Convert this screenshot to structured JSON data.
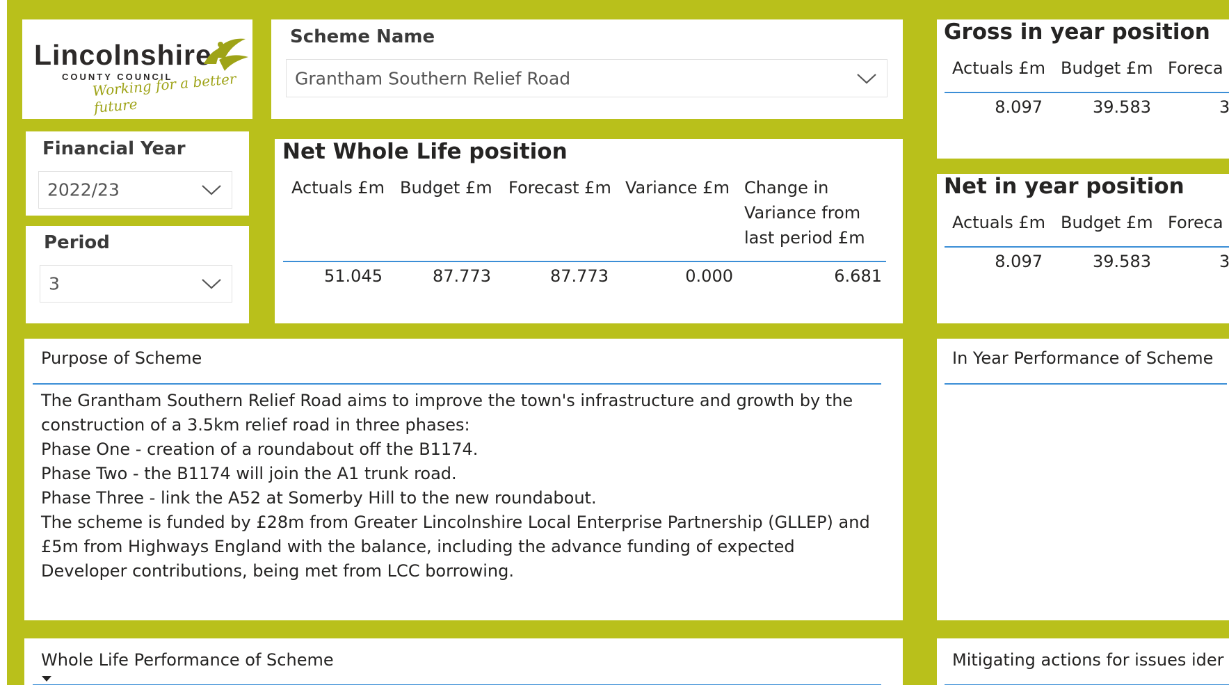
{
  "logo": {
    "name": "Lincolnshire",
    "council": "COUNTY COUNCIL",
    "tagline": "Working for a better future",
    "accent": "#9ea317"
  },
  "colors": {
    "background": "#b9c01b",
    "panel": "#ffffff",
    "rule": "#3b8ed6"
  },
  "scheme": {
    "title": "Scheme Name",
    "value": "Grantham Southern Relief Road"
  },
  "financial_year": {
    "title": "Financial Year",
    "value": "2022/23"
  },
  "period": {
    "title": "Period",
    "value": "3"
  },
  "net_whole_life": {
    "title": "Net Whole Life position",
    "headers": [
      "Actuals £m",
      "Budget £m",
      "Forecast £m",
      "Variance £m"
    ],
    "change_header": [
      "Change in",
      "Variance from",
      "last period £m"
    ],
    "values": [
      "51.045",
      "87.773",
      "87.773",
      "0.000",
      "6.681"
    ]
  },
  "gross_in_year": {
    "title": "Gross in year position",
    "headers": [
      "Actuals £m",
      "Budget £m",
      "Foreca"
    ],
    "values": [
      "8.097",
      "39.583",
      "3"
    ]
  },
  "net_in_year": {
    "title": "Net in year position",
    "headers": [
      "Actuals £m",
      "Budget £m",
      "Foreca"
    ],
    "values": [
      "8.097",
      "39.583",
      "3"
    ]
  },
  "purpose": {
    "title": "Purpose of Scheme",
    "lines": [
      "The Grantham Southern Relief Road aims to improve the town's infrastructure and growth by the",
      "construction of a 3.5km relief road in three phases:",
      "Phase One - creation of a roundabout off the B1174.",
      "Phase Two - the B1174 will join the A1 trunk road.",
      "Phase Three - link the A52 at Somerby Hill to the new roundabout.",
      "The scheme is funded by £28m from Greater Lincolnshire Local Enterprise Partnership (GLLEP) and",
      "£5m from Highways England with the balance, including the advance funding of expected",
      "Developer contributions, being met from LCC borrowing."
    ]
  },
  "in_year_performance": {
    "title": "In Year Performance of Scheme"
  },
  "whole_life_performance": {
    "title": "Whole Life Performance of Scheme"
  },
  "mitigating": {
    "title": "Mitigating actions for issues ider"
  }
}
